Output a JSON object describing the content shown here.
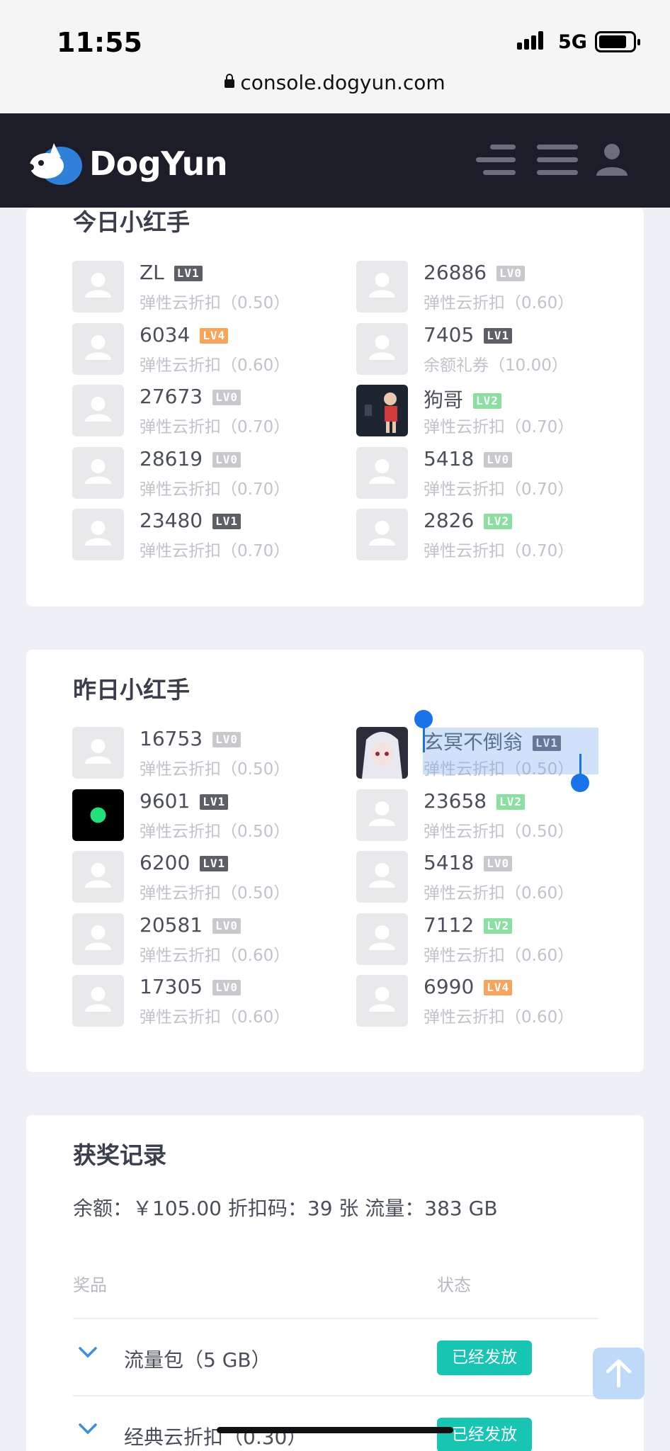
{
  "status_bar": {
    "time": "11:55",
    "network": "5G"
  },
  "browser": {
    "url": "console.dogyun.com"
  },
  "header": {
    "logo_text": "DogYun"
  },
  "today": {
    "title": "今日小红手",
    "entries": [
      {
        "name": "ZL",
        "level": "LV1",
        "prize": "弹性云折扣（0.50）"
      },
      {
        "name": "26886",
        "level": "LV0",
        "prize": "弹性云折扣（0.60）"
      },
      {
        "name": "6034",
        "level": "LV4",
        "prize": "弹性云折扣（0.60）"
      },
      {
        "name": "7405",
        "level": "LV1",
        "prize": "余额礼券（10.00）"
      },
      {
        "name": "27673",
        "level": "LV0",
        "prize": "弹性云折扣（0.70）"
      },
      {
        "name": "狗哥",
        "level": "LV2",
        "prize": "弹性云折扣（0.70）"
      },
      {
        "name": "28619",
        "level": "LV0",
        "prize": "弹性云折扣（0.70）"
      },
      {
        "name": "5418",
        "level": "LV0",
        "prize": "弹性云折扣（0.70）"
      },
      {
        "name": "23480",
        "level": "LV1",
        "prize": "弹性云折扣（0.70）"
      },
      {
        "name": "2826",
        "level": "LV2",
        "prize": "弹性云折扣（0.70）"
      }
    ]
  },
  "yesterday": {
    "title": "昨日小红手",
    "entries": [
      {
        "name": "16753",
        "level": "LV0",
        "prize": "弹性云折扣（0.50）"
      },
      {
        "name": "玄冥不倒翁",
        "level": "LV1",
        "prize": "弹性云折扣（0.50）"
      },
      {
        "name": "9601",
        "level": "LV1",
        "prize": "弹性云折扣（0.50）"
      },
      {
        "name": "23658",
        "level": "LV2",
        "prize": "弹性云折扣（0.50）"
      },
      {
        "name": "6200",
        "level": "LV1",
        "prize": "弹性云折扣（0.50）"
      },
      {
        "name": "5418",
        "level": "LV0",
        "prize": "弹性云折扣（0.60）"
      },
      {
        "name": "20581",
        "level": "LV0",
        "prize": "弹性云折扣（0.60）"
      },
      {
        "name": "7112",
        "level": "LV2",
        "prize": "弹性云折扣（0.60）"
      },
      {
        "name": "17305",
        "level": "LV0",
        "prize": "弹性云折扣（0.60）"
      },
      {
        "name": "6990",
        "level": "LV4",
        "prize": "弹性云折扣（0.60）"
      }
    ]
  },
  "records": {
    "title": "获奖记录",
    "summary": "余额：￥105.00   折扣码：39 张   流量：383 GB",
    "col_prize": "奖品",
    "col_status": "状态",
    "rows": [
      {
        "prize": "流量包（5 GB）",
        "status": "已经发放"
      },
      {
        "prize": "经典云折扣（0.30）",
        "status": "已经发放"
      }
    ]
  }
}
